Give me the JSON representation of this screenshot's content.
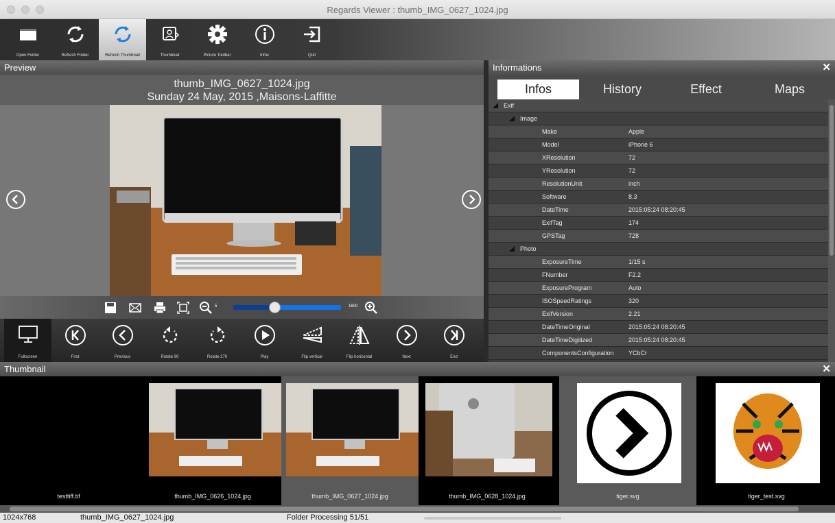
{
  "window": {
    "title": "Regards Viewer : thumb_IMG_0627_1024.jpg"
  },
  "toolbar": {
    "items": [
      {
        "label": "Open Folder",
        "icon": "folder-icon"
      },
      {
        "label": "Refresh Folder",
        "icon": "refresh-icon"
      },
      {
        "label": "Refresh Thumbnail",
        "icon": "refresh-icon",
        "active": true
      },
      {
        "label": "Thumbnail",
        "icon": "thumbnail-icon"
      },
      {
        "label": "Picture Toolbar",
        "icon": "gear-icon"
      },
      {
        "label": "Infos",
        "icon": "info-icon"
      },
      {
        "label": "Quit",
        "icon": "quit-icon"
      }
    ]
  },
  "preview": {
    "title": "Preview",
    "filename": "thumb_IMG_0627_1024.jpg",
    "date_place": "Sunday 24 May, 2015 ,Maisons-Laffitte",
    "zoom": {
      "min_label": "5",
      "max_label": "1600",
      "level_fraction": 0.38
    },
    "nav": [
      {
        "label": "Fullscreen",
        "icon": "fullscreen-icon",
        "active": true
      },
      {
        "label": "First",
        "icon": "first-icon"
      },
      {
        "label": "Previous",
        "icon": "previous-icon"
      },
      {
        "label": "Rotate 90",
        "icon": "rotate-left-icon"
      },
      {
        "label": "Rotate 270",
        "icon": "rotate-right-icon"
      },
      {
        "label": "Play",
        "icon": "play-icon"
      },
      {
        "label": "Flip vertical",
        "icon": "flip-vertical-icon"
      },
      {
        "label": "Flip horizontal",
        "icon": "flip-horizontal-icon"
      },
      {
        "label": "Next",
        "icon": "next-icon"
      },
      {
        "label": "End",
        "icon": "end-icon"
      }
    ]
  },
  "informations": {
    "title": "Informations",
    "tabs": [
      "Infos",
      "History",
      "Effect",
      "Maps"
    ],
    "active_tab": "Infos",
    "rows": [
      {
        "label": "Exif",
        "value": "",
        "level": 0,
        "group": true
      },
      {
        "label": "Image",
        "value": "",
        "level": 1,
        "group": true
      },
      {
        "label": "Make",
        "value": "Apple",
        "level": 2
      },
      {
        "label": "Model",
        "value": "iPhone 6",
        "level": 2
      },
      {
        "label": "XResolution",
        "value": "72",
        "level": 2
      },
      {
        "label": "YResolution",
        "value": "72",
        "level": 2
      },
      {
        "label": "ResolutionUnit",
        "value": "inch",
        "level": 2
      },
      {
        "label": "Software",
        "value": "8.3",
        "level": 2
      },
      {
        "label": "DateTime",
        "value": "2015:05:24 08:20:45",
        "level": 2
      },
      {
        "label": "ExifTag",
        "value": "174",
        "level": 2
      },
      {
        "label": "GPSTag",
        "value": "728",
        "level": 2
      },
      {
        "label": "Photo",
        "value": "",
        "level": 1,
        "group": true
      },
      {
        "label": "ExposureTime",
        "value": "1/15 s",
        "level": 2
      },
      {
        "label": "FNumber",
        "value": "F2.2",
        "level": 2
      },
      {
        "label": "ExposureProgram",
        "value": "Auto",
        "level": 2
      },
      {
        "label": "ISOSpeedRatings",
        "value": "320",
        "level": 2
      },
      {
        "label": "ExifVersion",
        "value": "2.21",
        "level": 2
      },
      {
        "label": "DateTimeOriginal",
        "value": "2015:05:24 08:20:45",
        "level": 2
      },
      {
        "label": "DateTimeDigitized",
        "value": "2015:05:24 08:20:45",
        "level": 2
      },
      {
        "label": "ComponentsConfiguration",
        "value": "YCbCr",
        "level": 2
      }
    ]
  },
  "thumbnails": {
    "title": "Thumbnail",
    "items": [
      {
        "caption": "testtiff.tif",
        "kind": "blank"
      },
      {
        "caption": "thumb_IMG_0626_1024.jpg",
        "kind": "imac"
      },
      {
        "caption": "thumb_IMG_0627_1024.jpg",
        "kind": "imac",
        "active": true
      },
      {
        "caption": "thumb_IMG_0628_1024.jpg",
        "kind": "imac-back"
      },
      {
        "caption": "tiger.svg",
        "kind": "arrow"
      },
      {
        "caption": "tiger_test.svg",
        "kind": "tiger"
      }
    ]
  },
  "status": {
    "dimensions": "1024x768",
    "filename": "thumb_IMG_0627_1024.jpg",
    "processing": "Folder Processing 51/51"
  },
  "colors": {
    "accent": "#1473e6",
    "panel_dark": "#3b3b3b"
  }
}
